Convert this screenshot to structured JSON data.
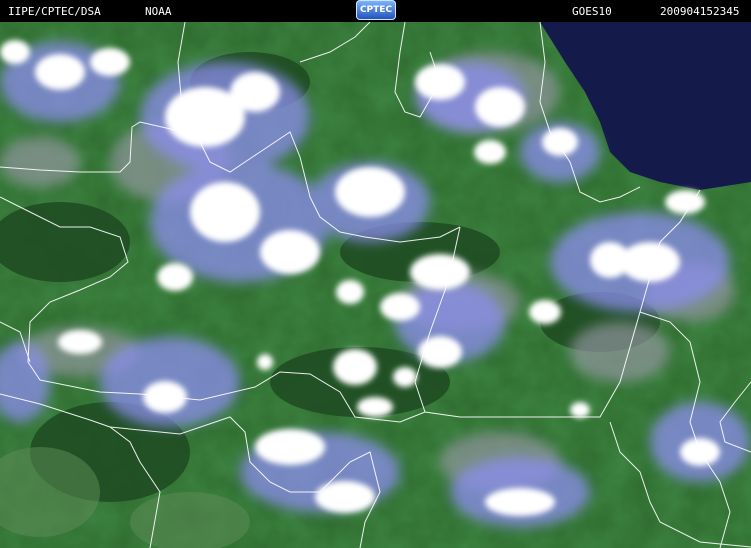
{
  "header": {
    "source": "IIPE/CPTEC/DSA",
    "agency": "NOAA",
    "logo": "CPTEC",
    "satellite": "GOES10",
    "timestamp": "200904152345"
  },
  "colors": {
    "vegetation": "#2e6b2e",
    "forest_dark": "#1f4f23",
    "ocean": "#141a4a",
    "cloud_core": "#ffffff",
    "cloud_edge": "#8d8df0",
    "border_line": "#ffffff"
  }
}
